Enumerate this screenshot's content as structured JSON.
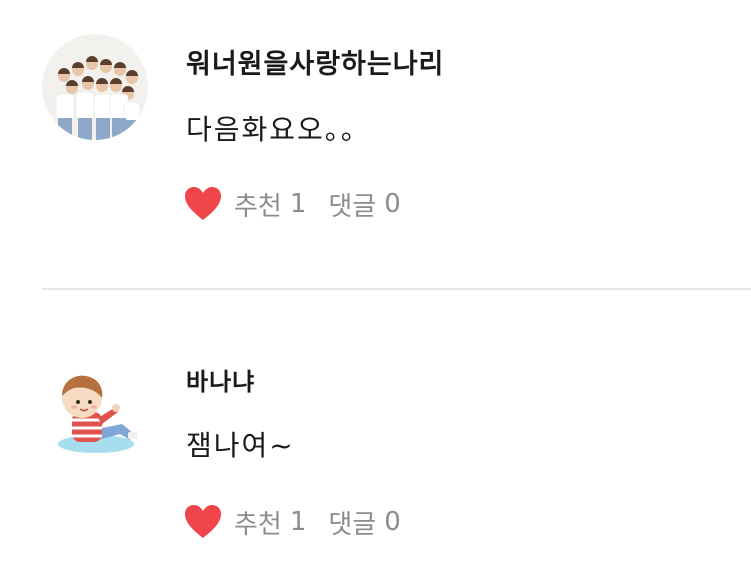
{
  "comments": [
    {
      "username": "워너원을사랑하는나리",
      "text": "다음화요오。。",
      "like_label": "추천",
      "like_count": "1",
      "reply_label": "댓글",
      "reply_count": "0"
    },
    {
      "username": "바나냐",
      "text": "잼나여~",
      "like_label": "추천",
      "like_count": "1",
      "reply_label": "댓글",
      "reply_count": "0"
    }
  ],
  "colors": {
    "heart": "#f0454a",
    "muted_text": "#8c8c8c",
    "divider": "#e6e6e6"
  }
}
